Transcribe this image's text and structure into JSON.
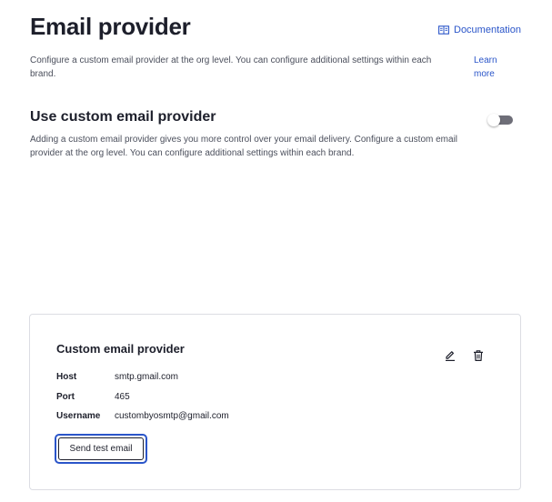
{
  "header": {
    "title": "Email provider",
    "documentation_link": "Documentation"
  },
  "intro": {
    "text": "Configure a custom email provider at the org level. You can configure additional settings within each brand.",
    "learn_more": "Learn more"
  },
  "custom_provider_section": {
    "title": "Use custom email provider",
    "description": "Adding a custom email provider gives you more control over your email delivery. Configure a custom email provider at the org level. You can configure additional settings within each brand.",
    "toggle_enabled": false
  },
  "provider_card": {
    "title": "Custom email provider",
    "fields": [
      {
        "label": "Host",
        "value": "smtp.gmail.com"
      },
      {
        "label": "Port",
        "value": "465"
      },
      {
        "label": "Username",
        "value": "custombyosmtp@gmail.com"
      }
    ],
    "send_test_label": "Send test email",
    "icons": [
      "edit-icon",
      "delete-icon"
    ]
  },
  "colors": {
    "accent": "#2a55c9",
    "text": "#1d1f2b",
    "muted_text": "#4b4f5c",
    "border": "#dcdde3"
  }
}
